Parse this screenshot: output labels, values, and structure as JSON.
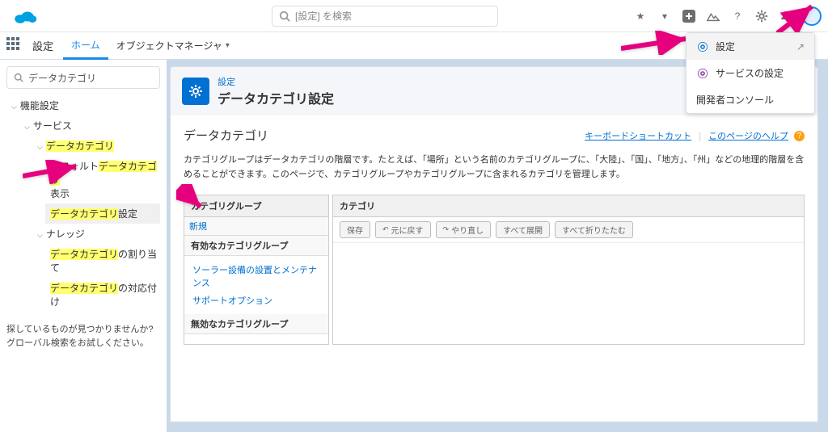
{
  "header": {
    "search_placeholder": "[設定] を検索"
  },
  "gear_menu": {
    "item_setup": "設定",
    "item_service": "サービスの設定",
    "item_devconsole": "開発者コンソール"
  },
  "context": {
    "title": "設定",
    "tab_home": "ホーム",
    "tab_object_manager": "オブジェクトマネージャ"
  },
  "sidebar": {
    "search_value": "データカテゴリ",
    "root": "機能設定",
    "service": "サービス",
    "data_category": "データカテゴリ",
    "default_view_prefix": "デフォルト",
    "default_view_hl": "データカテゴリ",
    "default_view_suffix": "表示",
    "dc_settings_hl": "データカテゴリ",
    "dc_settings_suffix": "設定",
    "knowledge": "ナレッジ",
    "dc_assign_hl": "データカテゴリ",
    "dc_assign_suffix": "の割り当て",
    "dc_map_hl": "データカテゴリ",
    "dc_map_suffix": "の対応付け",
    "hint_line1": "探しているものが見つかりませんか?",
    "hint_line2": "グローバル検索をお試しください。"
  },
  "page": {
    "eyebrow": "設定",
    "title": "データカテゴリ設定",
    "section_title": "データカテゴリ",
    "shortcut_link": "キーボードショートカット",
    "help_link": "このページのヘルプ",
    "description": "カテゴリグループはデータカテゴリの階層です。たとえば、「場所」という名前のカテゴリグループに、「大陸」、「国」、「地方」、「州」などの地理的階層を含めることができます。このページで、カテゴリグループやカテゴリグループに含まれるカテゴリを管理します。"
  },
  "panels": {
    "groups_header": "カテゴリグループ",
    "new_action": "新規",
    "active_header": "有効なカテゴリグループ",
    "inactive_header": "無効なカテゴリグループ",
    "group_items": [
      "ソーラー設備の設置とメンテナンス",
      "サポートオプション"
    ],
    "categories_header": "カテゴリ",
    "btn_save": "保存",
    "btn_undo": "元に戻す",
    "btn_redo": "やり直し",
    "btn_expand": "すべて展開",
    "btn_collapse": "すべて折りたたむ"
  }
}
